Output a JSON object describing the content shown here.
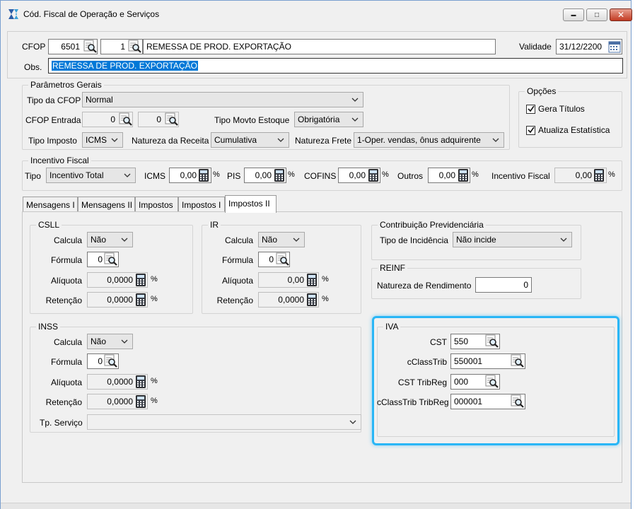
{
  "window": {
    "title": "Cód. Fiscal de Operação e Serviços",
    "controls": {
      "minimize": "▬",
      "maximize": "□",
      "close": "✕"
    }
  },
  "icons": {
    "lookup": "magnifier-icon",
    "calculator": "calculator-icon",
    "calendar": "calendar-icon",
    "dropdown": "chevron-down-icon"
  },
  "colors": {
    "highlight": "#29b6f6",
    "selection": "#0078d7"
  },
  "header": {
    "cfop_label": "CFOP",
    "cfop_code": "6501",
    "cfop_seq": "1",
    "cfop_desc": "REMESSA DE PROD. EXPORTAÇÃO",
    "validade_label": "Validade",
    "validade_value": "31/12/2200",
    "obs_label": "Obs.",
    "obs_value": "REMESSA DE PROD. EXPORTAÇÃO"
  },
  "parametros": {
    "title": "Parâmetros Gerais",
    "tipo_cfop_label": "Tipo da CFOP",
    "tipo_cfop_value": "Normal",
    "cfop_entrada_label": "CFOP Entrada",
    "cfop_entrada_1": "0",
    "cfop_entrada_2": "0",
    "tipo_movto_label": "Tipo Movto Estoque",
    "tipo_movto_value": "Obrigatória",
    "tipo_imposto_label": "Tipo Imposto",
    "tipo_imposto_value": "ICMS",
    "natureza_receita_label": "Natureza da Receita",
    "natureza_receita_value": "Cumulativa",
    "natureza_frete_label": "Natureza Frete",
    "natureza_frete_value": "1-Oper. vendas, ônus adquirente"
  },
  "opcoes": {
    "title": "Opções",
    "gera_titulos_label": "Gera Títulos",
    "gera_titulos_checked": true,
    "atualiza_estatistica_label": "Atualiza Estatística",
    "atualiza_estatistica_checked": true
  },
  "incentivo": {
    "title": "Incentivo Fiscal",
    "tipo_label": "Tipo",
    "tipo_value": "Incentivo Total",
    "icms_label": "ICMS",
    "icms_value": "0,00",
    "pis_label": "PIS",
    "pis_value": "0,00",
    "cofins_label": "COFINS",
    "cofins_value": "0,00",
    "outros_label": "Outros",
    "outros_value": "0,00",
    "incentivo_label": "Incentivo Fiscal",
    "incentivo_value": "0,00",
    "pct": "%"
  },
  "tabs": [
    {
      "label": "Mensagens I"
    },
    {
      "label": "Mensagens II"
    },
    {
      "label": "Impostos"
    },
    {
      "label": "Impostos I"
    },
    {
      "label": "Impostos II"
    }
  ],
  "csll": {
    "title": "CSLL",
    "calcula_label": "Calcula",
    "calcula_value": "Não",
    "formula_label": "Fórmula",
    "formula_value": "0",
    "aliquota_label": "Alíquota",
    "aliquota_value": "0,0000",
    "retencao_label": "Retenção",
    "retencao_value": "0,0000"
  },
  "ir": {
    "title": "IR",
    "calcula_label": "Calcula",
    "calcula_value": "Não",
    "formula_label": "Fórmula",
    "formula_value": "0",
    "aliquota_label": "Alíquota",
    "aliquota_value": "0,00",
    "retencao_label": "Retenção",
    "retencao_value": "0,0000"
  },
  "inss": {
    "title": "INSS",
    "calcula_label": "Calcula",
    "calcula_value": "Não",
    "formula_label": "Fórmula",
    "formula_value": "0",
    "aliquota_label": "Alíquota",
    "aliquota_value": "0,0000",
    "retencao_label": "Retenção",
    "retencao_value": "0,0000",
    "tp_servico_label": "Tp. Serviço",
    "tp_servico_value": ""
  },
  "contrib": {
    "title": "Contribuição Previdenciária",
    "tipo_incidencia_label": "Tipo de Incidência",
    "tipo_incidencia_value": "Não incide"
  },
  "reinf": {
    "title": "REINF",
    "natureza_label": "Natureza de Rendimento",
    "natureza_value": "0"
  },
  "iva": {
    "title": "IVA",
    "cst_label": "CST",
    "cst_value": "550",
    "cclass_label": "cClassTrib",
    "cclass_value": "550001",
    "cst_tribreg_label": "CST TribReg",
    "cst_tribreg_value": "000",
    "cclass_tribreg_label": "cClassTrib TribReg",
    "cclass_tribreg_value": "000001"
  }
}
